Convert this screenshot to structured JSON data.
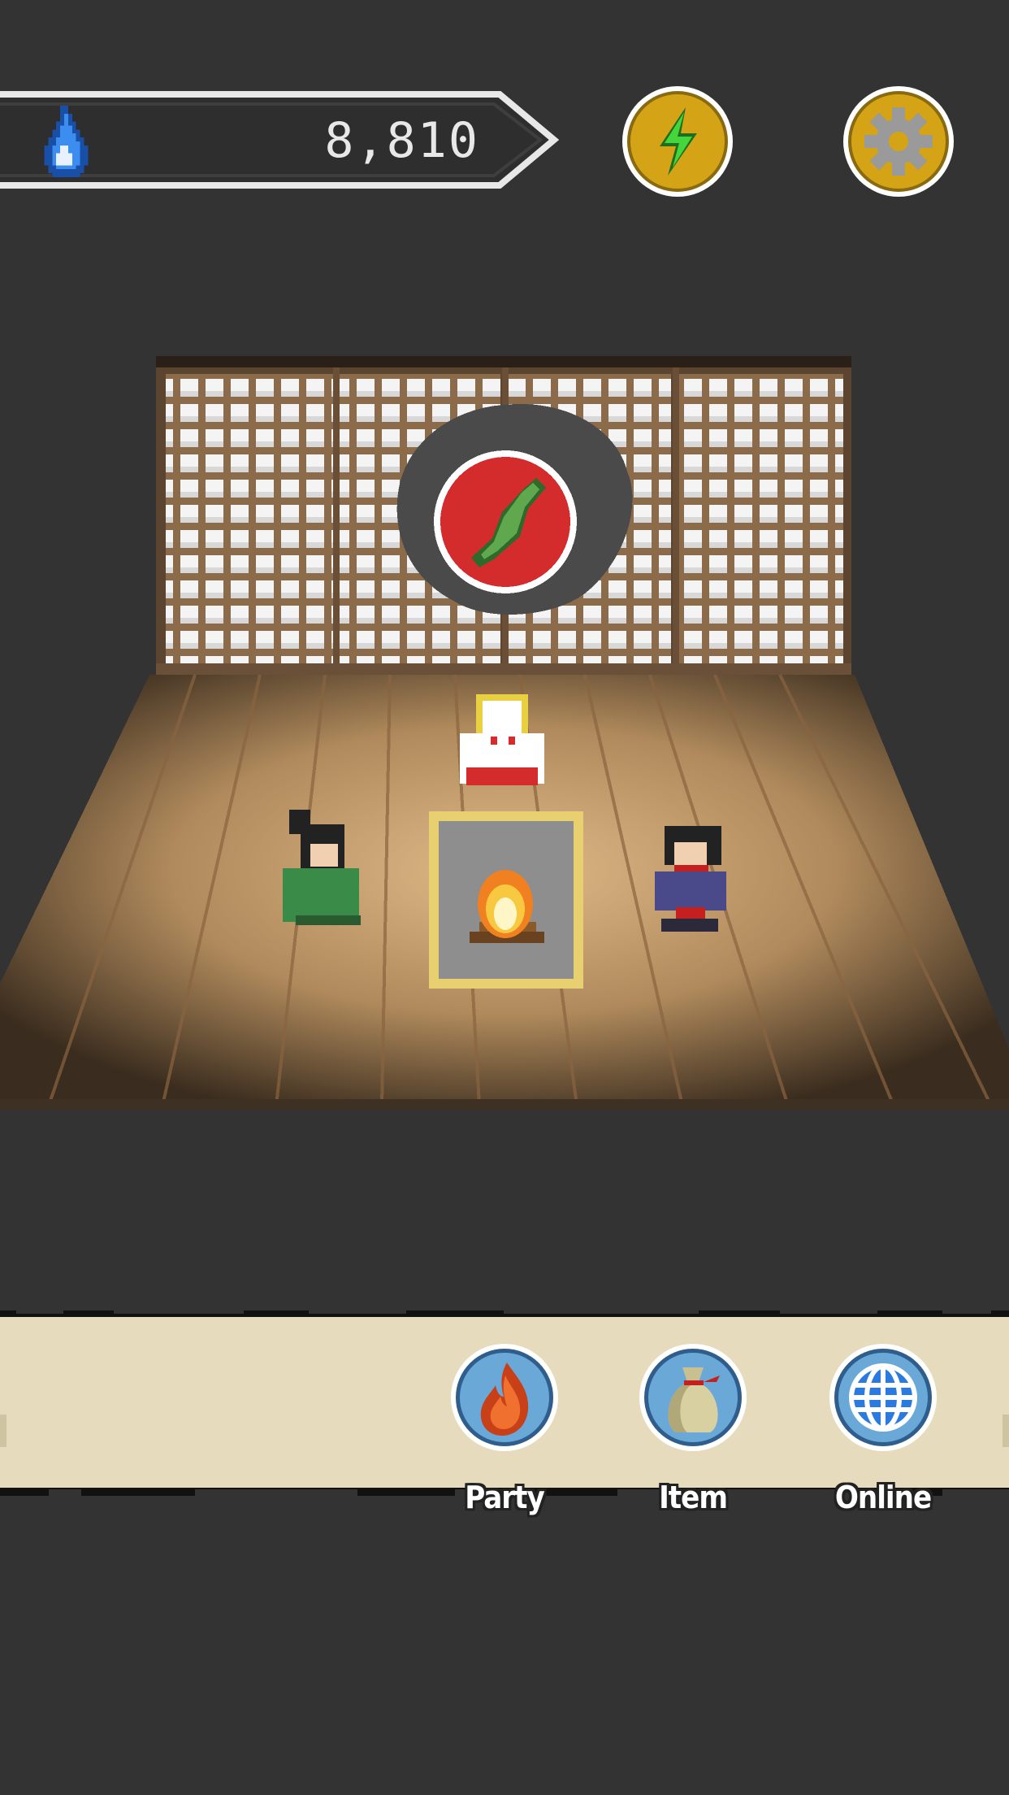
{
  "currency": {
    "icon": "blue-flame-icon",
    "value": "8,810"
  },
  "top_buttons": [
    {
      "name": "energy",
      "icon": "lightning-icon"
    },
    {
      "name": "settings",
      "icon": "gear-icon"
    }
  ],
  "scene": {
    "emblem_icon": "japan-map-icon",
    "characters": [
      "shrine-maiden-sprite",
      "green-ninja-sprite",
      "blue-ninja-sprite"
    ],
    "center_icon": "campfire-icon"
  },
  "menu": {
    "party_label": "Party",
    "item_label": "Item",
    "online_label": "Online"
  },
  "colors": {
    "background": "#333333",
    "bar_outline": "#e8e8e8",
    "gold": "#d4a416",
    "menu_parchment": "#e6dcbd",
    "button_blue": "#6aa8d8"
  }
}
